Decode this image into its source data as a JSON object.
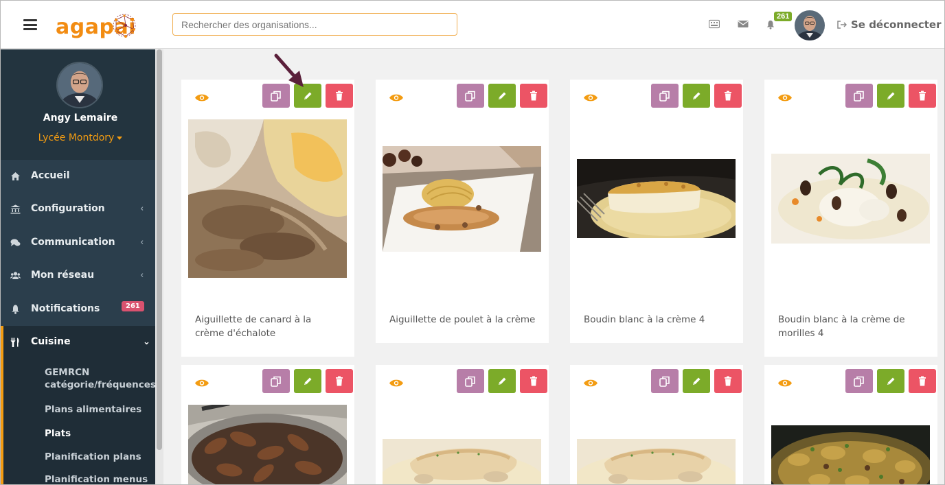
{
  "header": {
    "logo_text": "agapai",
    "search_placeholder": "Rechercher des organisations...",
    "notification_count": "261",
    "logout_label": "Se déconnecter"
  },
  "sidebar": {
    "user_name": "Angy Lemaire",
    "organization": "Lycée Montdory",
    "items": [
      {
        "label": "Accueil",
        "icon": "home-icon"
      },
      {
        "label": "Configuration",
        "icon": "bank-icon"
      },
      {
        "label": "Communication",
        "icon": "comments-icon"
      },
      {
        "label": "Mon réseau",
        "icon": "users-icon"
      },
      {
        "label": "Notifications",
        "icon": "bell-icon",
        "badge": "261"
      },
      {
        "label": "Cuisine",
        "icon": "cutlery-icon"
      }
    ],
    "cuisine_submenu": [
      {
        "label": "GEMRCN catégorie/fréquences"
      },
      {
        "label": "Plans alimentaires"
      },
      {
        "label": "Plats",
        "active": true
      },
      {
        "label": "Planification plans"
      },
      {
        "label": "Planification menus"
      }
    ]
  },
  "dishes": [
    {
      "title": "Aiguillette de canard à la crème d'échalote"
    },
    {
      "title": "Aiguillette de poulet à la crème"
    },
    {
      "title": "Boudin blanc à la crème 4"
    },
    {
      "title": "Boudin blanc à la crème de morilles 4"
    },
    {
      "title": ""
    },
    {
      "title": ""
    },
    {
      "title": ""
    },
    {
      "title": ""
    }
  ],
  "colors": {
    "accent": "#f39c12",
    "duplicate_button": "#b77ea8",
    "edit_button": "#7cab29",
    "delete_button": "#ec5465",
    "sidebar_bg": "#2b3e4c"
  }
}
